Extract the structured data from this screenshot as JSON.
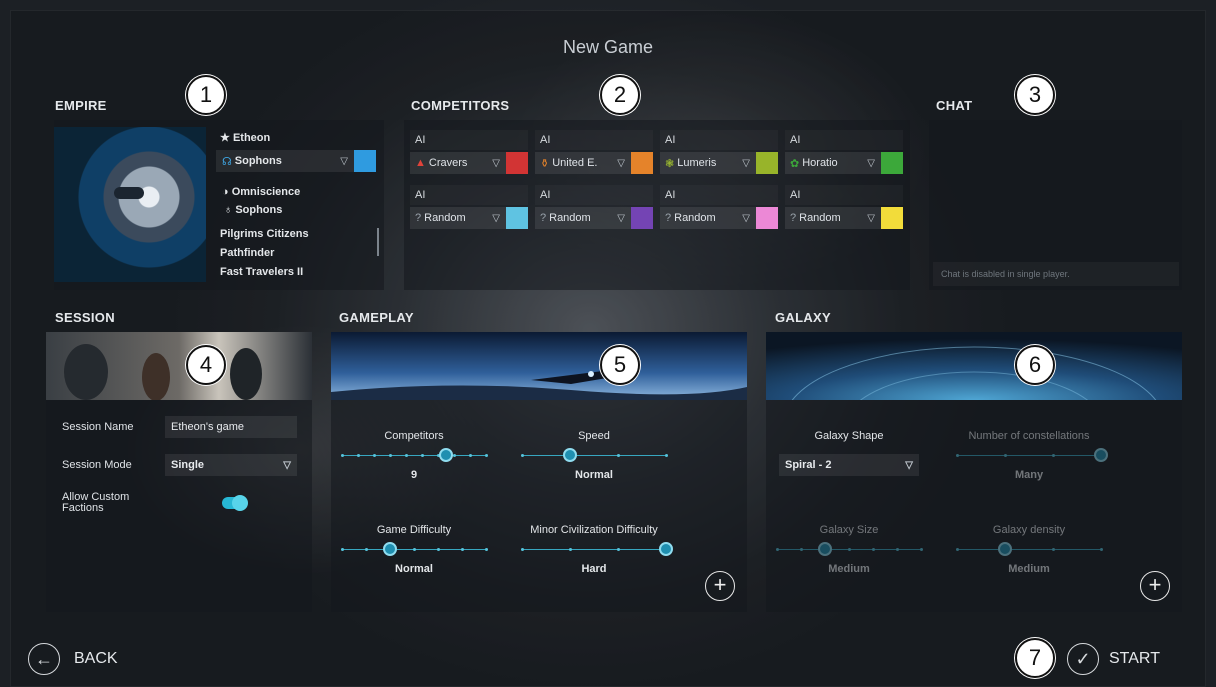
{
  "title": "New Game",
  "sections": {
    "empire": "EMPIRE",
    "competitors": "COMPETITORS",
    "chat": "CHAT",
    "session": "SESSION",
    "gameplay": "GAMEPLAY",
    "galaxy": "GALAXY"
  },
  "markers": [
    "1",
    "2",
    "3",
    "4",
    "5",
    "6",
    "7"
  ],
  "empire": {
    "leader": "Etheon",
    "faction": "Sophons",
    "faction_color": "#2f9be0",
    "affinity": "Omniscience",
    "population": "Sophons",
    "traits": [
      "Pilgrims Citizens",
      "Pathfinder",
      "Fast Travelers II"
    ]
  },
  "competitors": [
    {
      "label": "AI",
      "name": "Cravers",
      "color": "#d23434",
      "icon": "craver-icon"
    },
    {
      "label": "AI",
      "name": "United E.",
      "color": "#e5832a",
      "icon": "united-icon"
    },
    {
      "label": "AI",
      "name": "Lumeris",
      "color": "#98b42a",
      "icon": "lumeris-icon"
    },
    {
      "label": "AI",
      "name": "Horatio",
      "color": "#3ca83a",
      "icon": "horatio-icon"
    },
    {
      "label": "AI",
      "name": "Random",
      "color": "#5fc3e2",
      "icon": "random-icon"
    },
    {
      "label": "AI",
      "name": "Random",
      "color": "#7444b4",
      "icon": "random-icon"
    },
    {
      "label": "AI",
      "name": "Random",
      "color": "#ec88d6",
      "icon": "random-icon"
    },
    {
      "label": "AI",
      "name": "Random",
      "color": "#f2dc3a",
      "icon": "random-icon"
    }
  ],
  "chat": {
    "placeholder": "Chat is disabled in single player."
  },
  "session": {
    "name_label": "Session Name",
    "name_value": "Etheon's game",
    "mode_label": "Session Mode",
    "mode_value": "Single",
    "custom_label": "Allow Custom Factions",
    "custom_enabled": true
  },
  "gameplay": {
    "competitors": {
      "label": "Competitors",
      "value": "9",
      "position": 0.72
    },
    "speed": {
      "label": "Speed",
      "value": "Normal",
      "position": 0.33
    },
    "difficulty": {
      "label": "Game Difficulty",
      "value": "Normal",
      "position": 0.33
    },
    "minor": {
      "label": "Minor Civilization Difficulty",
      "value": "Hard",
      "position": 1.0
    }
  },
  "galaxy": {
    "shape": {
      "label": "Galaxy Shape",
      "value": "Spiral - 2"
    },
    "constellations": {
      "label": "Number of constellations",
      "value": "Many",
      "position": 1.0
    },
    "size": {
      "label": "Galaxy Size",
      "value": "Medium",
      "position": 0.33
    },
    "density": {
      "label": "Galaxy density",
      "value": "Medium",
      "position": 0.33
    }
  },
  "footer": {
    "back": "BACK",
    "start": "START"
  }
}
